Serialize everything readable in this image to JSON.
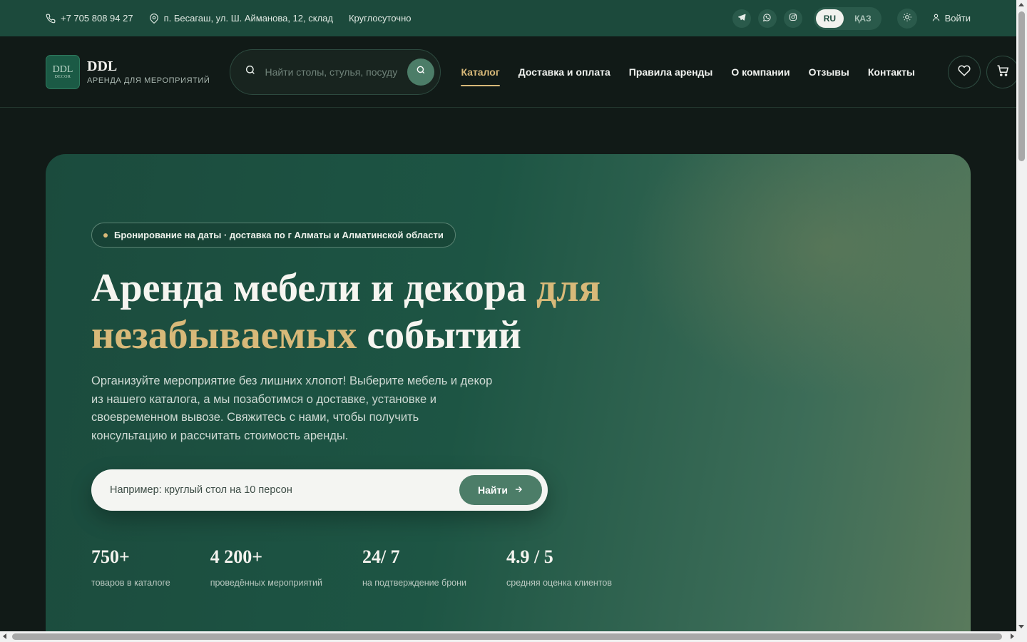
{
  "topbar": {
    "phone": "+7 705 808 94 27",
    "address": "п. Бесагаш, ул. Ш. Айманова, 12, склад",
    "hours": "Круглосуточно",
    "languages": [
      {
        "label": "RU",
        "active": true
      },
      {
        "label": "ҚАЗ",
        "active": false
      }
    ],
    "login_label": "Войти",
    "icons": [
      "phone-icon",
      "location-icon",
      "telegram-icon",
      "whatsapp-icon",
      "instagram-icon",
      "sun-icon",
      "user-icon"
    ]
  },
  "header": {
    "logo_text": "DDL",
    "logo_sub": "DECOR",
    "brand_name": "DDL",
    "brand_tagline": "АРЕНДА ДЛЯ МЕРОПРИЯТИЙ",
    "search_placeholder": "Найти столы, стулья, посуду",
    "nav": [
      {
        "label": "Каталог",
        "active": true
      },
      {
        "label": "Доставка и оплата",
        "active": false
      },
      {
        "label": "Правила аренды",
        "active": false
      },
      {
        "label": "О компании",
        "active": false
      },
      {
        "label": "Отзывы",
        "active": false
      },
      {
        "label": "Контакты",
        "active": false
      }
    ]
  },
  "hero": {
    "badge": "Бронирование на даты · доставка по г Алматы и Алматинской области",
    "title_part1": "Аренда мебели и декора ",
    "title_gold": "для незабываемых",
    "title_part2": " событий",
    "lead": "Организуйте мероприятие без лишних хлопот! Выберите мебель и декор из нашего каталога, а мы позаботимся о доставке, установке и своевременном вывозе. Свяжитесь с нами, чтобы получить консультацию и рассчитать стоимость аренды.",
    "search_placeholder": "Например: круглый стол на 10 персон",
    "search_button": "Найти",
    "stats": [
      {
        "value": "750+",
        "label": "товаров в каталоге"
      },
      {
        "value": "4 200+",
        "label": "проведённых мероприятий"
      },
      {
        "value": "24/ 7",
        "label": "на подтверждение брони"
      },
      {
        "value": "4.9 / 5",
        "label": "средняя оценка клиентов"
      }
    ]
  },
  "colors": {
    "topbar_bg": "#1c4a3c",
    "page_bg": "#111a17",
    "accent_gold": "#d8b979",
    "button_green": "#4c7d68"
  }
}
